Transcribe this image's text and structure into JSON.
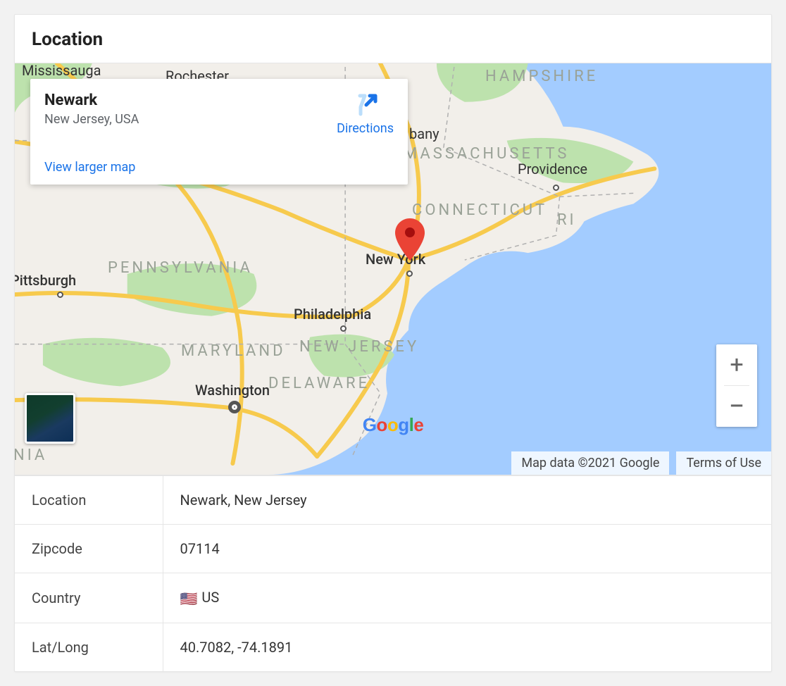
{
  "card_title": "Location",
  "map": {
    "info": {
      "place": "Newark",
      "region": "New Jersey, USA",
      "view_larger": "View larger map",
      "directions": "Directions"
    },
    "attribution": "Map data ©2021 Google",
    "terms": "Terms of Use",
    "visible_states": [
      "HAMPSHIRE",
      "MASSACHUSETTS",
      "CONNECTICUT",
      "RI",
      "PENNSYLVANIA",
      "NEW JERSEY",
      "MARYLAND",
      "DELAWARE",
      "NIA"
    ],
    "visible_cities": [
      "Rochester",
      "bany",
      "Providence",
      "New York",
      "Philadelphia",
      "Washington",
      "Pittsburgh",
      "Mississauga"
    ],
    "logo_letters": [
      "G",
      "o",
      "o",
      "g",
      "l",
      "e"
    ],
    "logo_colors": [
      "#4285F4",
      "#EA4335",
      "#FBBC05",
      "#4285F4",
      "#34A853",
      "#EA4335"
    ]
  },
  "details": [
    {
      "key": "Location",
      "value": "Newark, New Jersey"
    },
    {
      "key": "Zipcode",
      "value": "07114"
    },
    {
      "key": "Country",
      "value": "US",
      "flag": "🇺🇸"
    },
    {
      "key": "Lat/Long",
      "value": "40.7082, -74.1891"
    }
  ]
}
